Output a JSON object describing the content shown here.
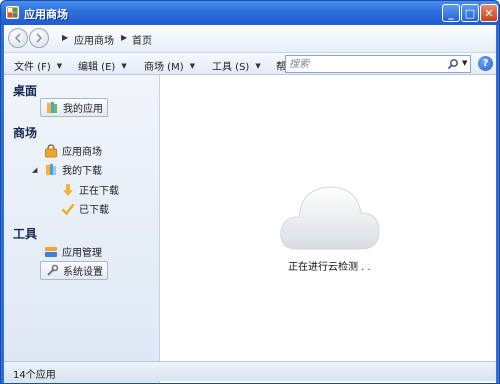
{
  "window": {
    "title": "应用商场",
    "minimize": "_",
    "maximize": "□",
    "close": "✕"
  },
  "address": {
    "crumbs": [
      "应用商场",
      "首页"
    ]
  },
  "toolbar": {
    "menus": [
      "文件 (F)",
      "编辑 (E)",
      "商场 (M)",
      "工具 (S)",
      "帮"
    ],
    "search_placeholder": "搜索",
    "help": "?"
  },
  "sidebar": {
    "section_desktop": "桌面",
    "my_apps": "我的应用",
    "section_store": "商场",
    "app_store": "应用商场",
    "my_downloads": "我的下载",
    "downloading": "正在下载",
    "downloaded": "已下载",
    "section_tools": "工具",
    "app_manager": "应用管理",
    "system_settings": "系统设置"
  },
  "main": {
    "status_message": "正在进行云检测 . ."
  },
  "statusbar": {
    "count_text": "14个应用"
  },
  "icons": {
    "app": "app-grid-icon",
    "back": "back-arrow-icon",
    "forward": "forward-arrow-icon",
    "search": "magnifier-icon",
    "cloud": "cloud-icon"
  }
}
